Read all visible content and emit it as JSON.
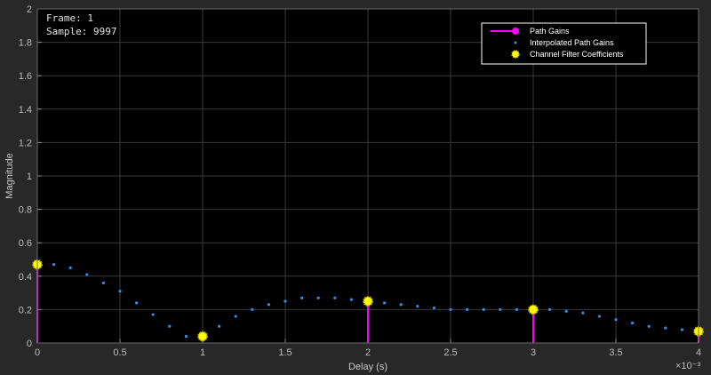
{
  "overlay": {
    "frame": "Frame: 1",
    "sample": "Sample: 9997"
  },
  "colors": {
    "path": "#ff00ff",
    "interp": "#2f8fe8",
    "coef_fill": "#ffff00",
    "coef_edge": "#c8b400",
    "axes_bg": "#000000",
    "fig_bg": "#282828"
  },
  "chart_data": {
    "type": "scatter",
    "xlabel": "Delay (s)",
    "ylabel": "Magnitude",
    "xlim": [
      0,
      4
    ],
    "ylim": [
      0,
      2
    ],
    "x_exponent": "×10⁻³",
    "xticks": [
      0,
      0.5,
      1,
      1.5,
      2,
      2.5,
      3,
      3.5,
      4
    ],
    "xtick_labels": [
      "0",
      "0.5",
      "1",
      "1.5",
      "2",
      "2.5",
      "3",
      "3.5",
      "4"
    ],
    "yticks": [
      0,
      0.2,
      0.4,
      0.6,
      0.8,
      1,
      1.2,
      1.4,
      1.6,
      1.8,
      2
    ],
    "ytick_labels": [
      "0",
      "0.2",
      "0.4",
      "0.6",
      "0.8",
      "1",
      "1.2",
      "1.4",
      "1.6",
      "1.8",
      "2"
    ],
    "legend": [
      "Path Gains",
      "Interpolated Path Gains",
      "Channel Filter Coefficients"
    ],
    "legend_position": "top-right",
    "series": [
      {
        "name": "Path Gains",
        "kind": "stem",
        "x": [
          0,
          2,
          3,
          4
        ],
        "y": [
          0.47,
          0.25,
          0.2,
          0.07
        ]
      },
      {
        "name": "Interpolated Path Gains",
        "kind": "dots",
        "x": [
          0.1,
          0.2,
          0.3,
          0.4,
          0.5,
          0.6,
          0.7,
          0.8,
          0.9,
          1.1,
          1.2,
          1.3,
          1.4,
          1.5,
          1.6,
          1.7,
          1.8,
          1.9,
          2.1,
          2.2,
          2.3,
          2.4,
          2.5,
          2.6,
          2.7,
          2.8,
          2.9,
          3.1,
          3.2,
          3.3,
          3.4,
          3.5,
          3.6,
          3.7,
          3.8,
          3.9
        ],
        "y": [
          0.47,
          0.45,
          0.41,
          0.36,
          0.31,
          0.24,
          0.17,
          0.1,
          0.04,
          0.1,
          0.16,
          0.2,
          0.23,
          0.25,
          0.27,
          0.27,
          0.27,
          0.26,
          0.24,
          0.23,
          0.22,
          0.21,
          0.2,
          0.2,
          0.2,
          0.2,
          0.2,
          0.2,
          0.19,
          0.18,
          0.16,
          0.14,
          0.12,
          0.1,
          0.09,
          0.08
        ]
      },
      {
        "name": "Channel Filter Coefficients",
        "kind": "markers",
        "x": [
          0,
          1,
          2,
          3,
          4
        ],
        "y": [
          0.47,
          0.04,
          0.25,
          0.2,
          0.07
        ]
      }
    ]
  }
}
